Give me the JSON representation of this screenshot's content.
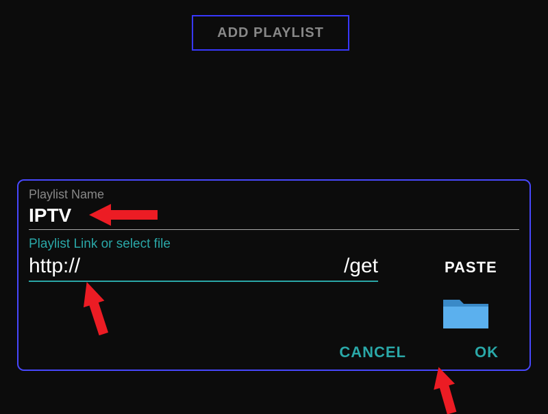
{
  "top_button": {
    "label": "ADD PLAYLIST"
  },
  "dialog": {
    "playlist_name_label": "Playlist Name",
    "playlist_name_value": "IPTV",
    "playlist_link_label": "Playlist Link or select file",
    "playlist_link_left": "http://",
    "playlist_link_right": "/get",
    "paste_label": "PASTE",
    "cancel_label": "CANCEL",
    "ok_label": "OK"
  },
  "colors": {
    "background": "#0c0c0c",
    "border_blue": "#4848ff",
    "teal": "#2aa8a8",
    "text_gray": "#888888",
    "text_white": "#ffffff",
    "arrow_red": "#ec1c24",
    "folder_blue": "#4a9fe0"
  }
}
